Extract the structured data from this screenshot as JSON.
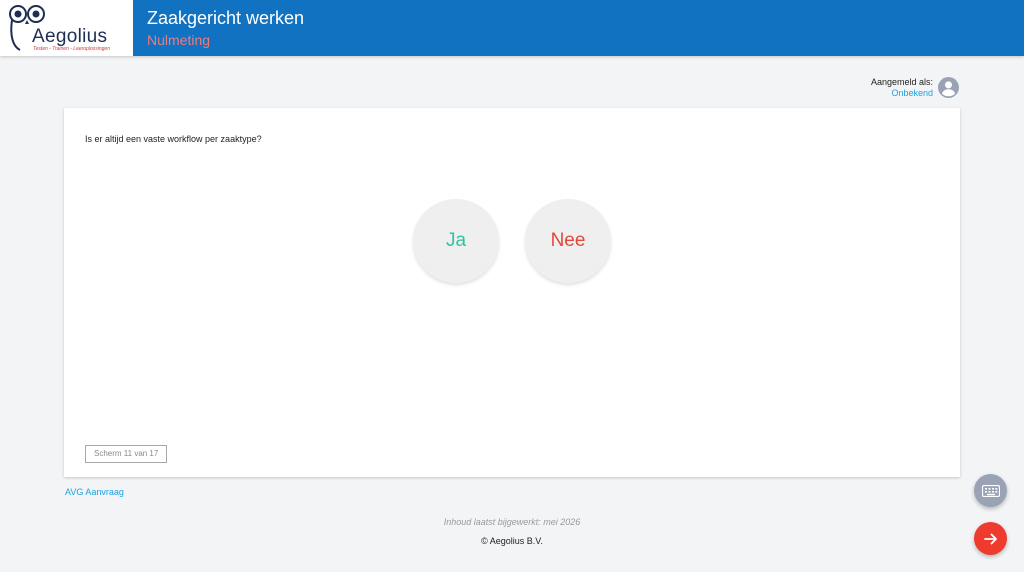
{
  "header": {
    "logo_text": "Aegolius",
    "logo_tagline": "Testen - Trainen - Leeroplossingen",
    "title": "Zaakgericht werken",
    "subtitle": "Nulmeting"
  },
  "user": {
    "label": "Aangemeld als:",
    "name": "Onbekend"
  },
  "question": {
    "text": "Is er altijd een vaste workflow per zaaktype?",
    "options": [
      "Ja",
      "Nee"
    ]
  },
  "screen_counter": "Scherm 11 van 17",
  "links": {
    "avg": "AVG Aanvraag"
  },
  "footer": {
    "updated": "Inhoud laatst bijgewerkt: mei 2026",
    "copyright": "© Aegolius B.V."
  },
  "colors": {
    "header_bg": "#1172c2",
    "accent_link": "#1aa3e0",
    "yes": "#2ec4a0",
    "no": "#e2473a",
    "fab_next": "#ef3b2d"
  },
  "icons": {
    "keyboard": "keyboard-icon",
    "next": "arrow-right-icon",
    "user": "account-circle-icon"
  }
}
